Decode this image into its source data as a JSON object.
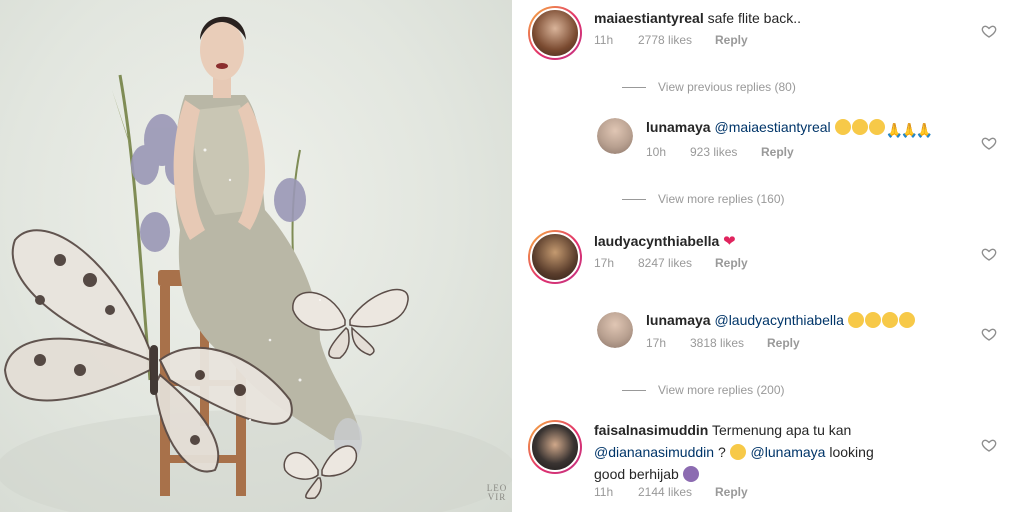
{
  "photo": {
    "watermark_line1": "LEO",
    "watermark_line2": "VIR"
  },
  "comments": [
    {
      "username": "maiaestiantyreal",
      "text": "safe flite back..",
      "time": "11h",
      "likes": "2778 likes",
      "reply": "Reply"
    },
    {
      "view_replies": "View previous replies (80)"
    },
    {
      "username": "lunamaya",
      "mention": "@maiaestiantyreal",
      "text": "",
      "time": "10h",
      "likes": "923 likes",
      "reply": "Reply"
    },
    {
      "view_replies": "View more replies (160)"
    },
    {
      "username": "laudyacynthiabella",
      "text": "",
      "time": "17h",
      "likes": "8247 likes",
      "reply": "Reply"
    },
    {
      "username": "lunamaya",
      "mention": "@laudyacynthiabella",
      "text": "",
      "time": "17h",
      "likes": "3818 likes",
      "reply": "Reply"
    },
    {
      "view_replies": "View more replies (200)"
    },
    {
      "username": "faisalnasimuddin",
      "text_line1": "Termenung apa tu kan",
      "mention1": "@diananasimuddin",
      "text_mid": " ? ",
      "mention2": "@lunamaya",
      "text_after": " looking",
      "text_line3": "good berhijab",
      "time": "11h",
      "likes": "2144 likes",
      "reply": "Reply"
    }
  ],
  "icons": {
    "like": "heart-outline-icon"
  },
  "colors": {
    "username": "#262626",
    "mention": "#003569",
    "meta": "#999999",
    "ring_start": "#f6b73c",
    "ring_end": "#c13584"
  }
}
